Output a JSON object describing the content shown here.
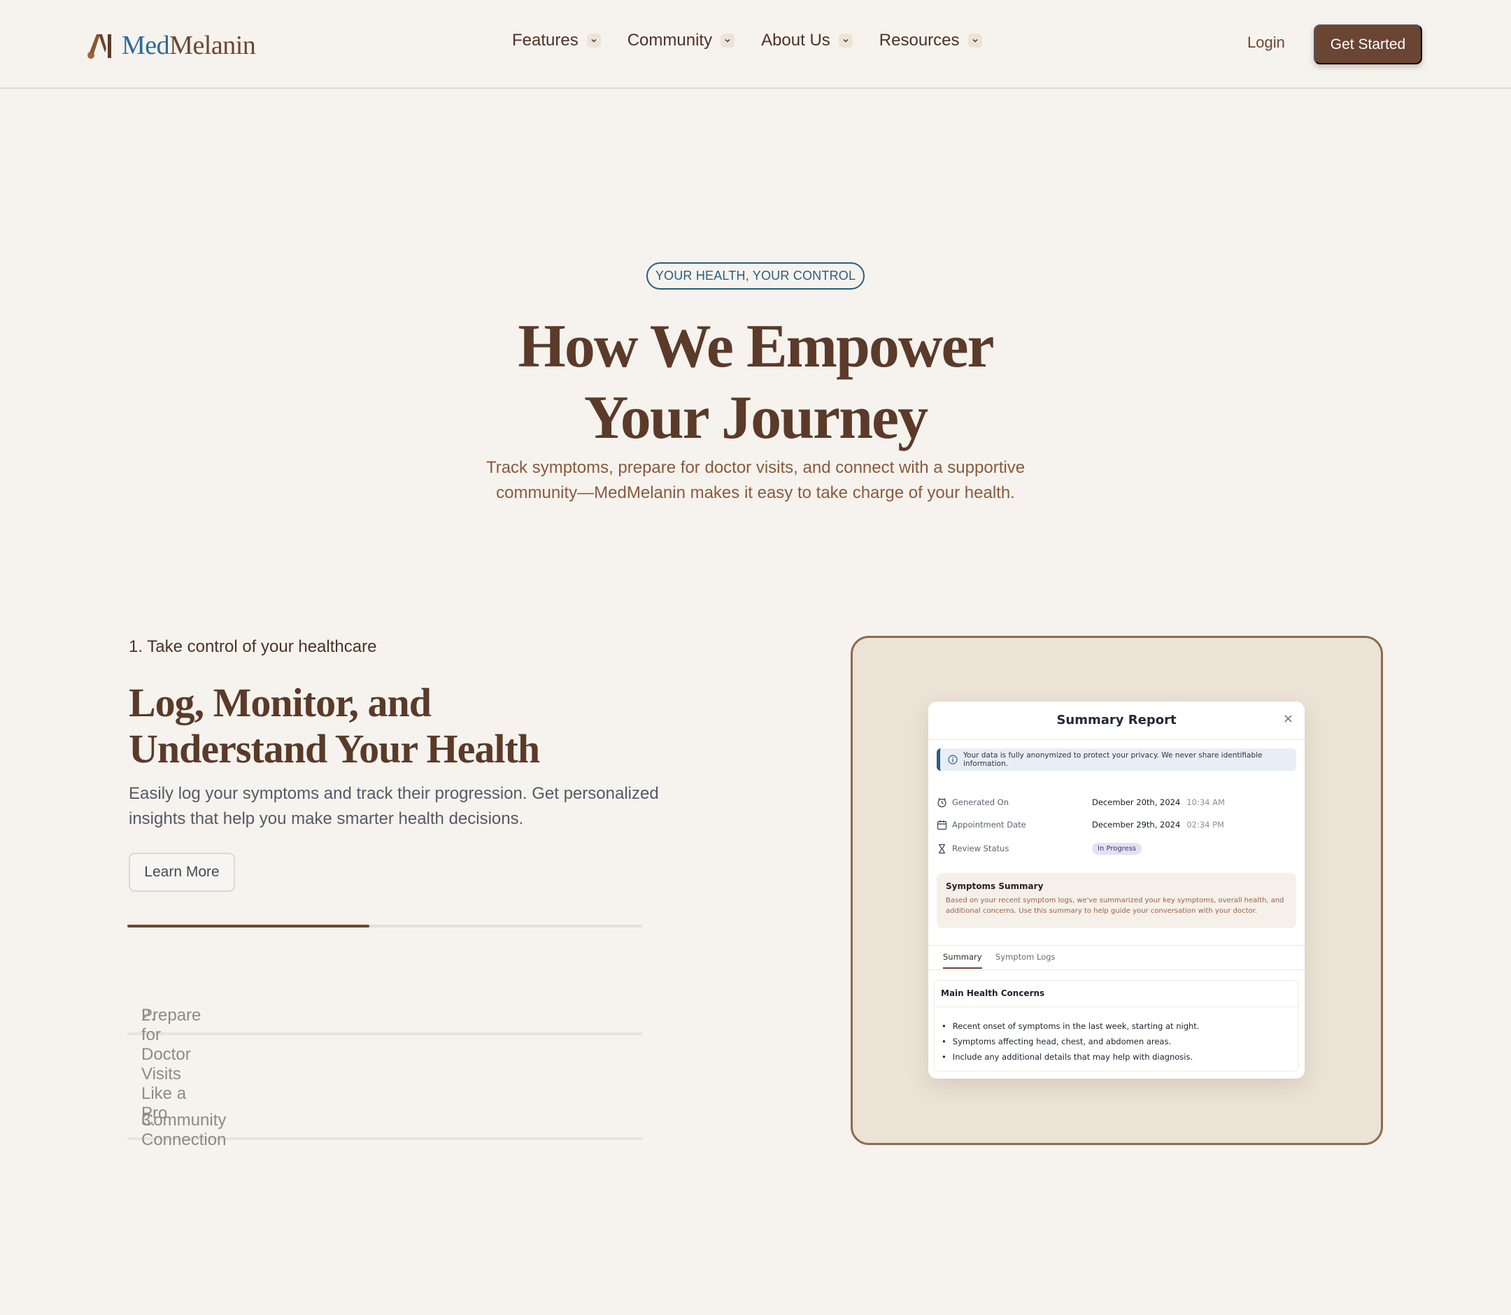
{
  "nav": {
    "logo": {
      "med": "Med",
      "melanin": "Melanin"
    },
    "menu": [
      {
        "label": "Features"
      },
      {
        "label": "Community"
      },
      {
        "label": "About Us"
      },
      {
        "label": "Resources"
      }
    ],
    "login_label": "Login",
    "cta_label": "Get Started"
  },
  "hero": {
    "eyebrow": "YOUR HEALTH, YOUR CONTROL",
    "title_line1": "How We Empower",
    "title_line2": "Your Journey",
    "subtitle": "Track symptoms, prepare for doctor visits, and connect with a supportive community—MedMelanin makes it easy to take charge of your health."
  },
  "feature": {
    "step_label": "1. Take control of your healthcare",
    "title_line1": "Log, Monitor, and",
    "title_line2": "Understand Your Health",
    "description": "Easily log your symptoms and track their progression. Get personalized insights that help you make smarter health decisions.",
    "learn_more_label": "Learn More",
    "progress": 0.47,
    "other_steps": [
      {
        "number": "2.",
        "label": "Prepare for Doctor Visits Like a Pro"
      },
      {
        "number": "3.",
        "label": "Community Connection"
      }
    ]
  },
  "report": {
    "title": "Summary Report",
    "close_glyph": "×",
    "privacy_note": "Your data is fully anonymized to protect your privacy. We never share identifiable information.",
    "meta": [
      {
        "icon": "clock-icon",
        "label": "Generated On",
        "value": "December 20th, 2024",
        "time": "10:34 AM"
      },
      {
        "icon": "calendar-icon",
        "label": "Appointment Date",
        "value": "December 29th, 2024",
        "time": "02:34 PM"
      },
      {
        "icon": "hourglass-icon",
        "label": "Review Status",
        "status": "In Progress"
      }
    ],
    "symptoms_summary": {
      "title": "Symptoms Summary",
      "text": "Based on your recent symptom logs, we've summarized your key symptoms, overall health, and additional concerns. Use this summary to help guide your conversation with your doctor."
    },
    "tabs": [
      {
        "label": "Summary",
        "active": true
      },
      {
        "label": "Symptom Logs",
        "active": false
      }
    ],
    "concerns": {
      "title": "Main Health Concerns",
      "items": [
        "Recent onset of symptoms in the last week, starting at night.",
        "Symptoms affecting head, chest, and abdomen areas.",
        "Include any additional details that may help with diagnosis."
      ]
    }
  },
  "colors": {
    "background": "#f6f3ee",
    "brand_brown": "#6a4534",
    "brand_blue": "#2b5c80",
    "card_bg": "#ebe3d6",
    "card_border": "#8f6a4c"
  }
}
